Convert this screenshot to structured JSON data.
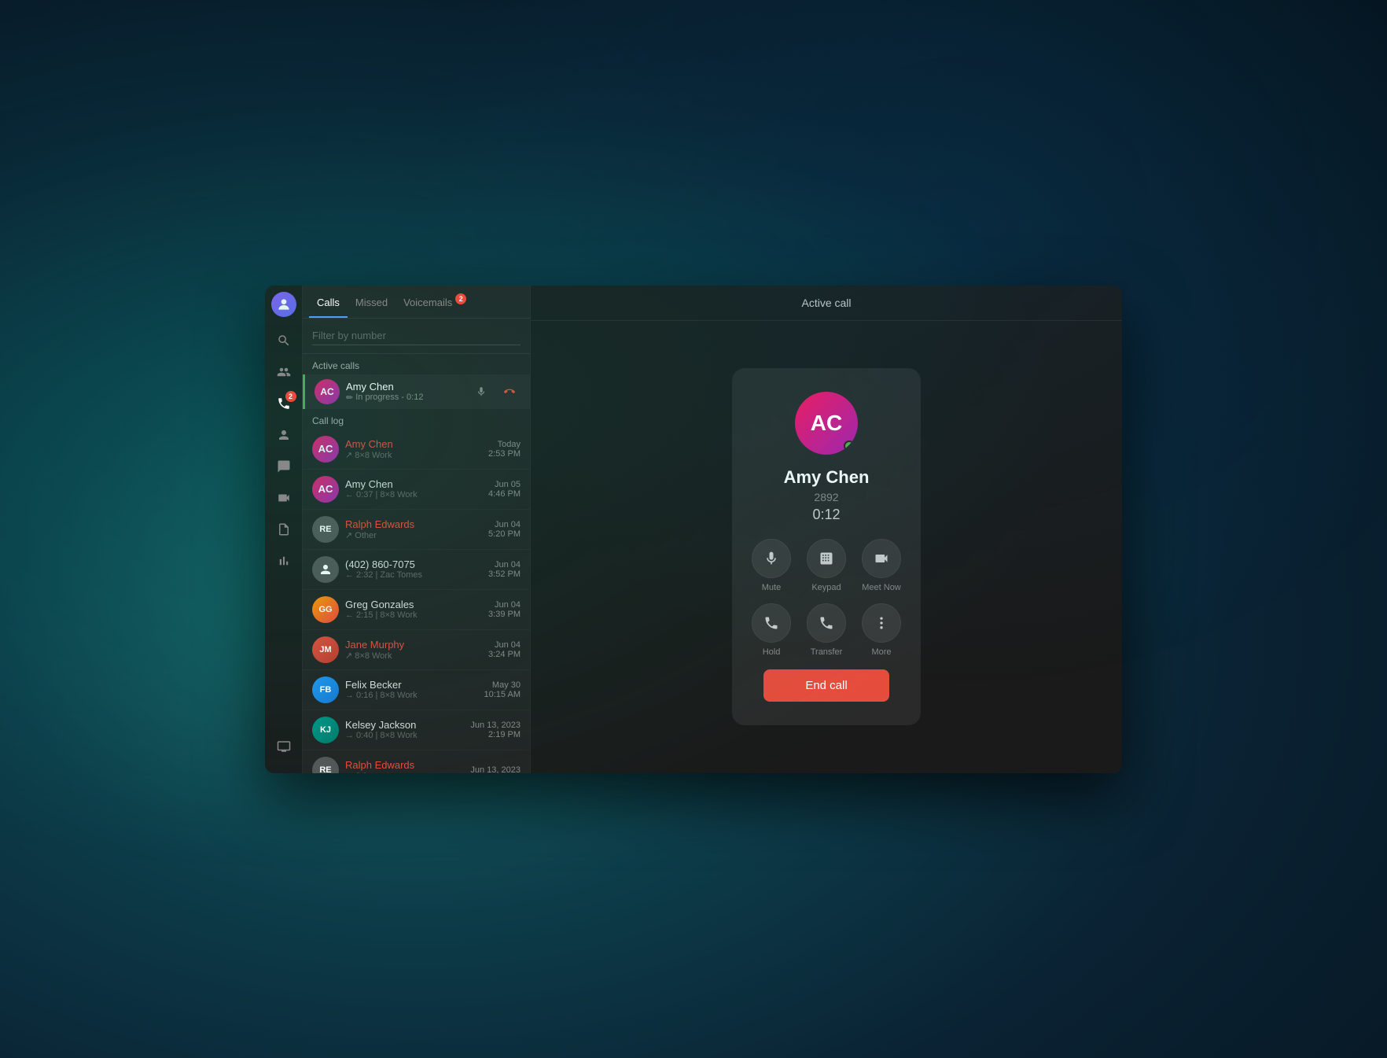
{
  "window": {
    "title": "Active call"
  },
  "tabs": [
    {
      "id": "calls",
      "label": "Calls",
      "active": true,
      "badge": null
    },
    {
      "id": "missed",
      "label": "Missed",
      "active": false,
      "badge": null
    },
    {
      "id": "voicemails",
      "label": "Voicemails",
      "active": false,
      "badge": "2"
    }
  ],
  "search": {
    "placeholder": "Filter by number"
  },
  "active_calls_section": {
    "label": "Active calls",
    "item": {
      "name": "Amy Chen",
      "status": "In progress - 0:12"
    }
  },
  "call_log_section": {
    "label": "Call log",
    "items": [
      {
        "name": "Amy Chen",
        "meta": "↗ 8×8 Work",
        "date": "Today",
        "time": "2:53 PM",
        "missed": false,
        "avatar_initials": "AC",
        "avatar_class": "av-pink"
      },
      {
        "name": "Amy Chen",
        "meta": "← 0:37 | 8×8 Work",
        "date": "Jun 05",
        "time": "4:46 PM",
        "missed": false,
        "avatar_initials": "AC",
        "avatar_class": "av-pink"
      },
      {
        "name": "Ralph Edwards",
        "meta": "↗ Other",
        "date": "Jun 04",
        "time": "5:20 PM",
        "missed": true,
        "avatar_initials": "RE",
        "avatar_class": "av-gray"
      },
      {
        "name": "(402) 860-7075",
        "meta": "← 2:32 | Zac Tomes",
        "date": "Jun 04",
        "time": "3:52 PM",
        "missed": false,
        "avatar_initials": "#",
        "avatar_class": "av-gray"
      },
      {
        "name": "Greg Gonzales",
        "meta": "← 2:15 | 8×8 Work",
        "date": "Jun 04",
        "time": "3:39 PM",
        "missed": false,
        "avatar_initials": "GG",
        "avatar_class": "av-orange"
      },
      {
        "name": "Jane Murphy",
        "meta": "↗ 8×8 Work",
        "date": "Jun 04",
        "time": "3:24 PM",
        "missed": true,
        "avatar_initials": "JM",
        "avatar_class": "av-red"
      },
      {
        "name": "Felix Becker",
        "meta": "→ 0:16 | 8×8 Work",
        "date": "May 30",
        "time": "10:15 AM",
        "missed": false,
        "avatar_initials": "FB",
        "avatar_class": "av-blue"
      },
      {
        "name": "Kelsey Jackson",
        "meta": "→ 0:40 | 8×8 Work",
        "date": "Jun 13, 2023",
        "time": "2:19 PM",
        "missed": false,
        "avatar_initials": "KJ",
        "avatar_class": "av-teal"
      },
      {
        "name": "Ralph Edwards",
        "meta": "↗ Other",
        "date": "Jun 13, 2023",
        "time": "",
        "missed": true,
        "avatar_initials": "RE",
        "avatar_class": "av-gray"
      }
    ]
  },
  "active_call_card": {
    "caller_name": "Amy Chen",
    "caller_ext": "2892",
    "call_time": "0:12",
    "controls": [
      {
        "id": "mute",
        "label": "Mute",
        "icon": "mic"
      },
      {
        "id": "keypad",
        "label": "Keypad",
        "icon": "keypad"
      },
      {
        "id": "meet_now",
        "label": "Meet Now",
        "icon": "video"
      }
    ],
    "controls2": [
      {
        "id": "hold",
        "label": "Hold",
        "icon": "hold"
      },
      {
        "id": "transfer",
        "label": "Transfer",
        "icon": "transfer"
      },
      {
        "id": "more",
        "label": "More",
        "icon": "more"
      }
    ],
    "end_call_label": "End call"
  },
  "sidebar": {
    "nav_items": [
      {
        "id": "search",
        "icon": "search",
        "active": false
      },
      {
        "id": "contacts",
        "icon": "contacts",
        "active": false
      },
      {
        "id": "calls",
        "icon": "phone",
        "active": true,
        "badge": "2"
      },
      {
        "id": "person",
        "icon": "person",
        "active": false
      },
      {
        "id": "chat",
        "icon": "chat",
        "active": false
      },
      {
        "id": "video",
        "icon": "video",
        "active": false
      },
      {
        "id": "doc",
        "icon": "doc",
        "active": false
      },
      {
        "id": "analytics",
        "icon": "analytics",
        "active": false
      }
    ],
    "bottom_items": [
      {
        "id": "monitor",
        "icon": "monitor"
      }
    ]
  }
}
